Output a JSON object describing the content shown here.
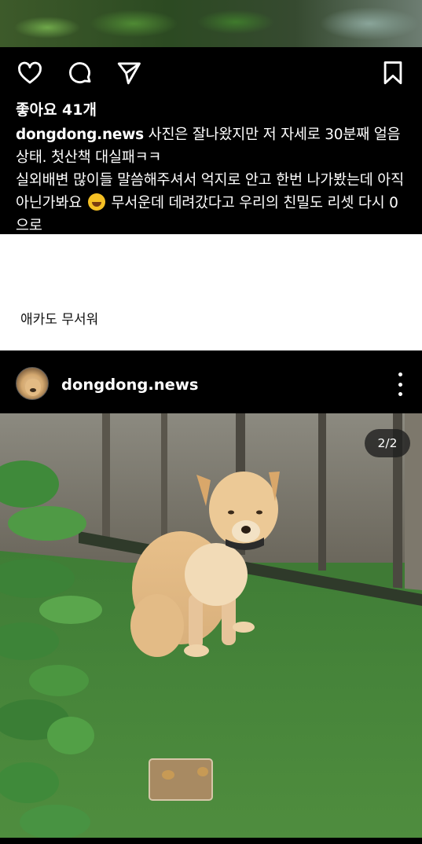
{
  "actions": {
    "like_icon": "heart-icon",
    "comment_icon": "comment-icon",
    "share_icon": "send-icon",
    "save_icon": "bookmark-icon"
  },
  "post1": {
    "likes": "좋아요 41개",
    "username": "dongdong.news",
    "caption_line1": "사진은 잘나왔지만 저 자세로 30분째 얼음 상태. 첫산책 대실패ㅋㅋ",
    "caption_line2a": "실외배변 많이들 말씀해주셔서 억지로 안고 한번 나가봤는데 아직 아닌가봐요",
    "caption_line2b": "무서운데 데려갔다고 우리의 친밀도 리셋 다시 0으로"
  },
  "comment": {
    "text": "애카도 무서워"
  },
  "post2": {
    "username": "dongdong.news",
    "page_indicator": "2/2"
  },
  "colors": {
    "background": "#000000",
    "comment_bg": "#ffffff",
    "text": "#ffffff"
  }
}
